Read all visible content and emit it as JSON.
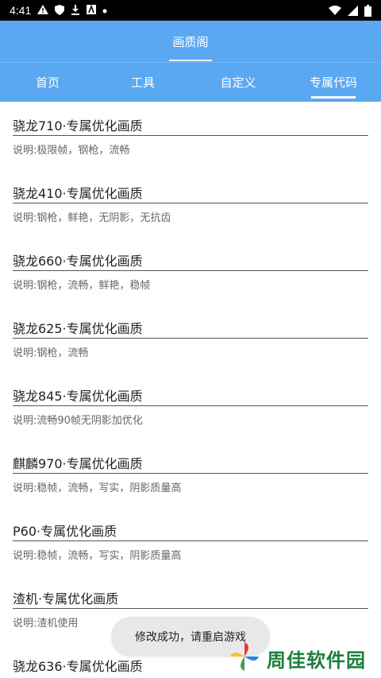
{
  "status_bar": {
    "time": "4:41",
    "icons_left": [
      "warning-icon",
      "shield-icon",
      "download-icon",
      "font-icon",
      "dot-icon"
    ],
    "icons_right": [
      "wifi-icon",
      "cellular-icon",
      "battery-icon"
    ]
  },
  "header": {
    "title": "画质阁",
    "tabs": [
      {
        "label": "首页"
      },
      {
        "label": "工具"
      },
      {
        "label": "自定义"
      },
      {
        "label": "专属代码"
      }
    ],
    "active_tab": "专属代码",
    "color": "#5aa8f1"
  },
  "items": [
    {
      "title": "骁龙710·专属优化画质",
      "desc": "说明:极限帧，钢枪，流畅"
    },
    {
      "title": "骁龙410·专属优化画质",
      "desc": "说明:钢枪，鲜艳，无阴影，无抗齿"
    },
    {
      "title": "骁龙660·专属优化画质",
      "desc": "说明:钢枪，流畅，鲜艳，稳帧"
    },
    {
      "title": "骁龙625·专属优化画质",
      "desc": "说明:钢枪，流畅"
    },
    {
      "title": "骁龙845·专属优化画质",
      "desc": "说明:流畅90帧无阴影加优化"
    },
    {
      "title": "麒麟970·专属优化画质",
      "desc": "说明:稳帧，流畅，写实，阴影质量高"
    },
    {
      "title": "P60·专属优化画质",
      "desc": "说明:稳帧，流畅，写实，阴影质量高"
    },
    {
      "title": "渣机·专属优化画质",
      "desc": "说明:渣机使用"
    },
    {
      "title": "骁龙636·专属优化画质",
      "desc": ""
    }
  ],
  "toast": {
    "text": "修改成功，请重启游戏"
  },
  "watermark": {
    "text": "周佳软件园"
  }
}
